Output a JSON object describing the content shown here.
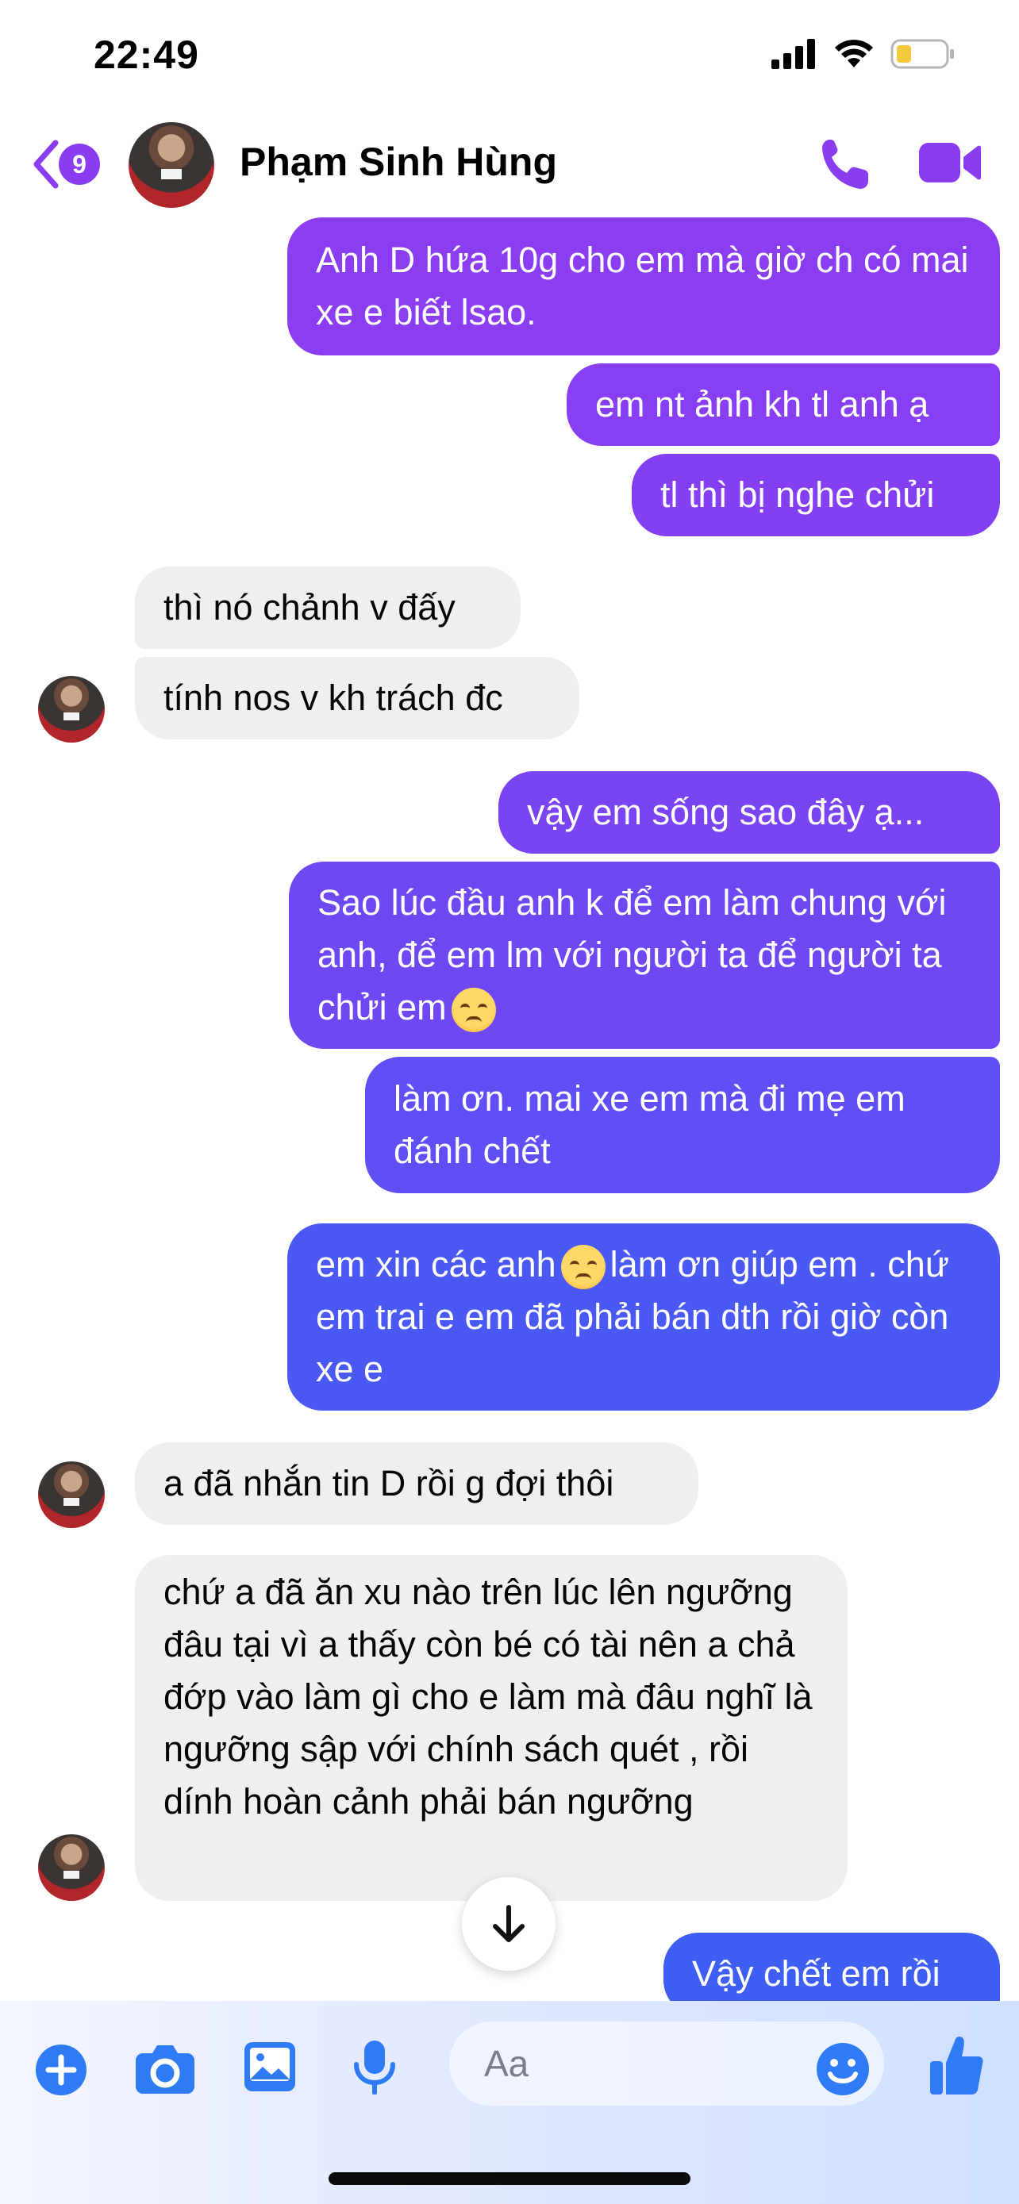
{
  "status": {
    "time": "22:49"
  },
  "header": {
    "back_count": "9",
    "contact_name": "Phạm Sinh Hùng"
  },
  "messages": [
    {
      "dir": "out",
      "text": "Anh D hứa 10g cho em mà giờ ch có mai xe e biết lsao."
    },
    {
      "dir": "out",
      "text": "em nt ảnh kh tl anh ạ"
    },
    {
      "dir": "out",
      "text": "tl thì bị nghe chửi"
    },
    {
      "dir": "in",
      "text": "thì nó chảnh v đấy"
    },
    {
      "dir": "in",
      "text": "tính nos v kh trách đc"
    },
    {
      "dir": "out",
      "text": "vậy em sống sao đây ạ..."
    },
    {
      "dir": "out",
      "text_before": "Sao lúc đầu anh k để em làm chung với anh, để em lm với người ta để người ta chửi em",
      "emoji": "disappointed-face",
      "text_after": ""
    },
    {
      "dir": "out",
      "text": "làm ơn. mai xe em mà đi mẹ em đánh chết"
    },
    {
      "dir": "out",
      "text_before": "em xin các anh",
      "emoji": "disappointed-face",
      "text_after": "làm ơn giúp em . chứ em trai e em đã phải bán dth rồi giờ còn xe e"
    },
    {
      "dir": "in",
      "text": "a đã nhắn tin D rồi g đợi thôi"
    },
    {
      "dir": "in",
      "text": "chứ a đã ăn xu nào trên lúc lên ngưỡng đâu tại vì a thấy còn bé có tài nên a chả đớp vào làm gì cho e làm mà đâu nghĩ là ngưỡng sập với chính sách quét , rồi dính hoàn cảnh phải bán ngưỡng"
    },
    {
      "dir": "out",
      "text": "Vậy chết em rồi"
    }
  ],
  "composer": {
    "placeholder": "Aa",
    "icons": [
      "plus-icon",
      "camera-icon",
      "gallery-icon",
      "microphone-icon",
      "emoji-icon",
      "thumbs-up-icon"
    ]
  },
  "colors": {
    "accent": "#8a3cf0",
    "bubble_out_top": "#8b3df2",
    "bubble_out_bottom": "#3f5ef4",
    "bubble_in": "#efefef",
    "composer_icon": "#2f7bf5"
  }
}
